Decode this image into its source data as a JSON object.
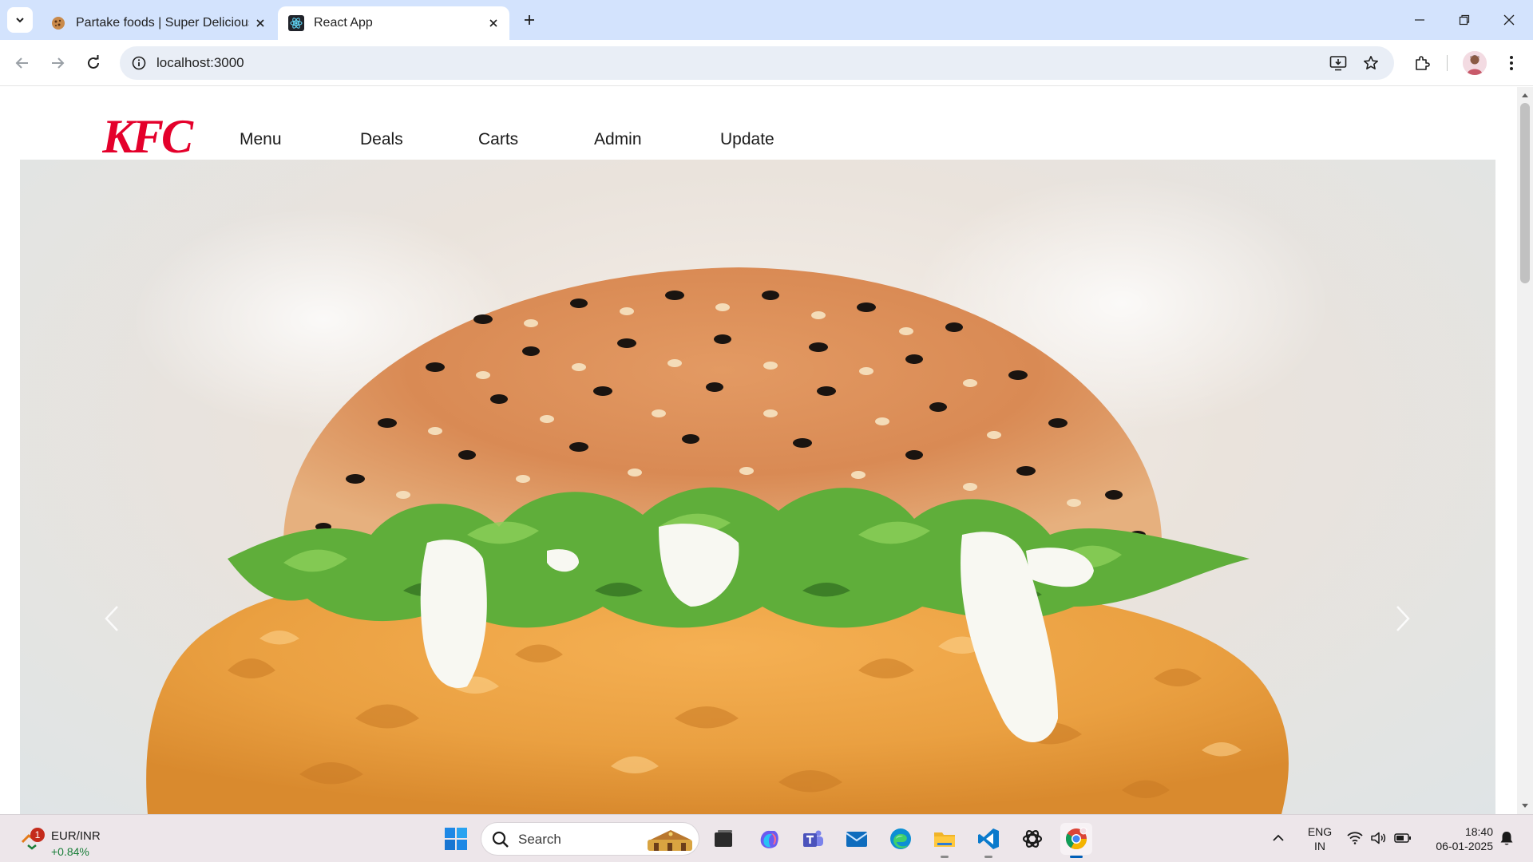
{
  "browser": {
    "tabs": [
      {
        "title": "Partake foods | Super Delicious",
        "favicon": "cookie-icon",
        "active": false
      },
      {
        "title": "React App",
        "favicon": "react-icon",
        "active": true
      }
    ],
    "url": "localhost:3000"
  },
  "site": {
    "logo_text": "KFC",
    "nav": [
      "Menu",
      "Deals",
      "Carts",
      "Admin",
      "Update"
    ],
    "hero": {
      "image": "crispy-chicken-burger",
      "prev_icon": "chevron-left-icon",
      "next_icon": "chevron-right-icon"
    }
  },
  "taskbar": {
    "widget": {
      "label": "EUR/INR",
      "change": "+0.84%",
      "badge": "1"
    },
    "search_placeholder": "Search",
    "language": {
      "line1": "ENG",
      "line2": "IN"
    },
    "clock": {
      "time": "18:40",
      "date": "06-01-2025"
    }
  },
  "colors": {
    "brand": "#e4002b",
    "tabbar": "#d3e3fd",
    "taskbar": "#ede6ea"
  }
}
